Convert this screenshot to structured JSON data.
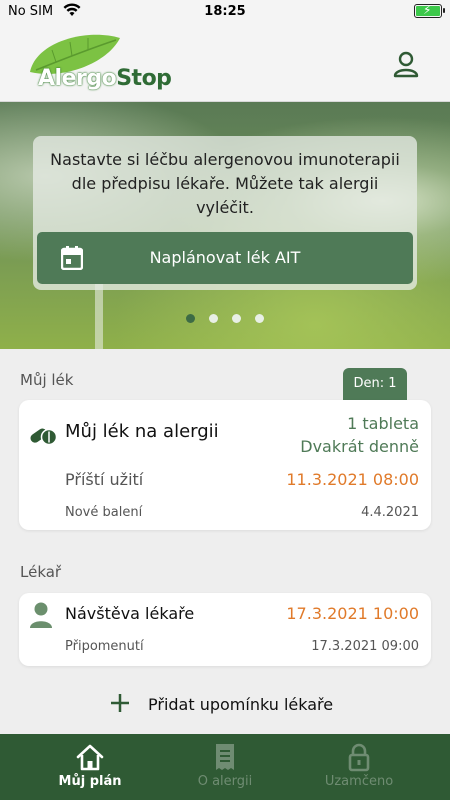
{
  "status_bar": {
    "carrier": "No SIM",
    "time": "18:25"
  },
  "header": {
    "logo_part1": "Alergo",
    "logo_part2": "Stop",
    "profile_icon": "person-icon"
  },
  "hero": {
    "text": "Nastavte si léčbu alergenovou imunoterapii dle předpisu lékaře. Můžete tak alergii vyléčit.",
    "button_label": "Naplánovat lék AIT",
    "button_icon": "calendar-icon",
    "carousel_pages": 4,
    "carousel_active": 1
  },
  "medicine_section": {
    "title": "Můj lék",
    "day_badge": "Den: 1",
    "name": "Můj lék na alergii",
    "dose_line1": "1 tableta",
    "dose_line2": "Dvakrát denně",
    "next_label": "Příští užití",
    "next_value": "11.3.2021 08:00",
    "pack_label": "Nové balení",
    "pack_value": "4.4.2021"
  },
  "doctor_section": {
    "title": "Lékař",
    "visit_label": "Návštěva lékaře",
    "visit_value": "17.3.2021 10:00",
    "remind_label": "Připomenutí",
    "remind_value": "17.3.2021 09:00",
    "add_reminder": "Přidat upomínku lékaře"
  },
  "tabbar": {
    "tabs": [
      {
        "label": "Můj plán",
        "icon": "home-icon",
        "active": true
      },
      {
        "label": "O alergii",
        "icon": "document-icon",
        "active": false
      },
      {
        "label": "Uzamčeno",
        "icon": "lock-icon",
        "active": false
      }
    ]
  },
  "colors": {
    "brand_green": "#4f7a57",
    "tabbar_green": "#2f5a34",
    "accent_orange": "#e07a2a"
  }
}
